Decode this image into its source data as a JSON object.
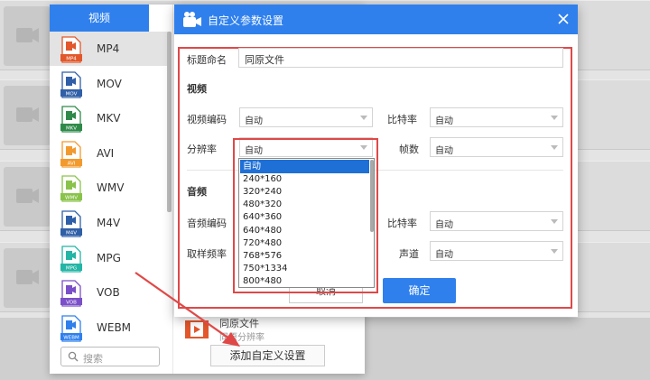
{
  "format_panel": {
    "tab_label": "视频",
    "formats": [
      {
        "label": "MP4",
        "icon": "mp4-file-icon",
        "color": "#e2572b",
        "badge": "MP4"
      },
      {
        "label": "MOV",
        "icon": "mov-file-icon",
        "color": "#2f5fa7",
        "badge": "MOV"
      },
      {
        "label": "MKV",
        "icon": "mkv-file-icon",
        "color": "#2f8a4a",
        "badge": "MKV"
      },
      {
        "label": "AVI",
        "icon": "avi-file-icon",
        "color": "#f29a2e",
        "badge": "AVI"
      },
      {
        "label": "WMV",
        "icon": "wmv-file-icon",
        "color": "#8ac34a",
        "badge": "WMV"
      },
      {
        "label": "M4V",
        "icon": "m4v-file-icon",
        "color": "#2f5fa7",
        "badge": "M4V"
      },
      {
        "label": "MPG",
        "icon": "mpg-file-icon",
        "color": "#23b5a5",
        "badge": "MPG"
      },
      {
        "label": "VOB",
        "icon": "vob-file-icon",
        "color": "#7b4fc8",
        "badge": "VOB"
      },
      {
        "label": "WEBM",
        "icon": "webm-file-icon",
        "color": "#2f80ed",
        "badge": "WEBM"
      }
    ],
    "search_placeholder": "搜索",
    "custom_item": {
      "name": "同原文件",
      "sub": "同原分辨率"
    },
    "add_custom_button": "添加自定义设置"
  },
  "dialog": {
    "title": "自定义参数设置",
    "title_name_label": "标题命名",
    "title_name_value": "同原文件",
    "video_section": "视频",
    "video_codec_label": "视频编码",
    "video_codec_value": "自动",
    "video_bitrate_label": "比特率",
    "video_bitrate_value": "自动",
    "resolution_label": "分辨率",
    "resolution_value": "自动",
    "framerate_label": "帧数",
    "framerate_value": "自动",
    "audio_section": "音频",
    "audio_codec_label": "音频编码",
    "audio_bitrate_label": "比特率",
    "audio_bitrate_value": "自动",
    "samplerate_label": "取样频率",
    "channel_label": "声道",
    "channel_value": "自动",
    "cancel_button": "取消",
    "ok_button": "确定"
  },
  "resolution_dropdown": {
    "options": [
      "自动",
      "240*160",
      "320*240",
      "480*320",
      "640*360",
      "640*480",
      "720*480",
      "768*576",
      "750*1334",
      "800*480"
    ],
    "selected_index": 0
  },
  "colors": {
    "accent": "#2f80ed",
    "highlight": "#e04848"
  }
}
